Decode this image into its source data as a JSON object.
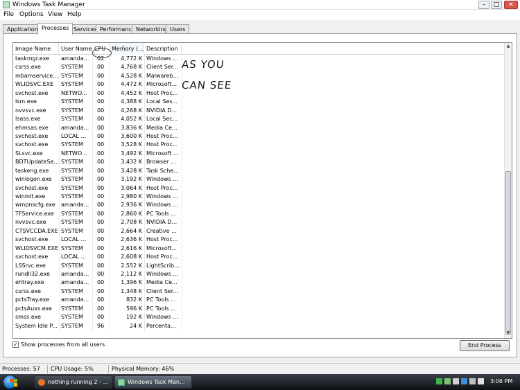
{
  "window": {
    "title": "Windows Task Manager",
    "controls": [
      "–",
      "□",
      "✕"
    ]
  },
  "menu": [
    "File",
    "Options",
    "View",
    "Help"
  ],
  "tabs": [
    "Applications",
    "Processes",
    "Services",
    "Performance",
    "Networking",
    "Users"
  ],
  "active_tab": "Processes",
  "columns": [
    "Image Name",
    "User Name",
    "CPU",
    "Memory (...",
    "Description"
  ],
  "processes": [
    [
      "taskmgr.exe",
      "amanda...",
      "02",
      "4,772 K",
      "Windows ..."
    ],
    [
      "csrss.exe",
      "SYSTEM",
      "00",
      "4,768 K",
      "Client Ser..."
    ],
    [
      "mbamservice....",
      "SYSTEM",
      "00",
      "4,528 K",
      "Malwareb..."
    ],
    [
      "WLIDSVC.EXE",
      "SYSTEM",
      "00",
      "4,472 K",
      "Microsoft..."
    ],
    [
      "svchost.exe",
      "NETWO...",
      "00",
      "4,452 K",
      "Host Proc..."
    ],
    [
      "lsm.exe",
      "SYSTEM",
      "00",
      "4,388 K",
      "Local Ses..."
    ],
    [
      "nvvsvc.exe",
      "SYSTEM",
      "00",
      "4,268 K",
      "NVIDIA D..."
    ],
    [
      "lsass.exe",
      "SYSTEM",
      "00",
      "4,052 K",
      "Local Sec..."
    ],
    [
      "ehmsas.exe",
      "amanda...",
      "00",
      "3,836 K",
      "Media Ce..."
    ],
    [
      "svchost.exe",
      "LOCAL ...",
      "00",
      "3,600 K",
      "Host Proc..."
    ],
    [
      "svchost.exe",
      "SYSTEM",
      "00",
      "3,528 K",
      "Host Proc..."
    ],
    [
      "SLsvc.exe",
      "NETWO...",
      "00",
      "3,492 K",
      "Microsoft ..."
    ],
    [
      "BDTUpdateSe...",
      "SYSTEM",
      "00",
      "3,432 K",
      "Browser ..."
    ],
    [
      "taskeng.exe",
      "SYSTEM",
      "00",
      "3,428 K",
      "Task Sche..."
    ],
    [
      "winlogon.exe",
      "SYSTEM",
      "00",
      "3,192 K",
      "Windows ..."
    ],
    [
      "svchost.exe",
      "SYSTEM",
      "00",
      "3,064 K",
      "Host Proc..."
    ],
    [
      "wininit.exe",
      "SYSTEM",
      "00",
      "2,980 K",
      "Windows ..."
    ],
    [
      "wmpnscfg.exe",
      "amanda...",
      "00",
      "2,936 K",
      "Windows ..."
    ],
    [
      "TFService.exe",
      "SYSTEM",
      "00",
      "2,860 K",
      "PC Tools ..."
    ],
    [
      "nvvsvc.exe",
      "SYSTEM",
      "00",
      "2,708 K",
      "NVIDIA D..."
    ],
    [
      "CTSVCCDA.EXE",
      "SYSTEM",
      "00",
      "2,664 K",
      "Creative ..."
    ],
    [
      "svchost.exe",
      "LOCAL ...",
      "00",
      "2,636 K",
      "Host Proc..."
    ],
    [
      "WLIDSVCM.EXE",
      "SYSTEM",
      "00",
      "2,616 K",
      "Microsoft..."
    ],
    [
      "svchost.exe",
      "LOCAL ...",
      "00",
      "2,608 K",
      "Host Proc..."
    ],
    [
      "LSSrvc.exe",
      "SYSTEM",
      "00",
      "2,552 K",
      "LightScrib..."
    ],
    [
      "rundll32.exe",
      "amanda...",
      "00",
      "2,112 K",
      "Windows ..."
    ],
    [
      "ehtray.exe",
      "amanda...",
      "00",
      "1,396 K",
      "Media Ce..."
    ],
    [
      "csrss.exe",
      "SYSTEM",
      "00",
      "1,348 K",
      "Client Ser..."
    ],
    [
      "pctsTray.exe",
      "amanda...",
      "00",
      "832 K",
      "PC Tools ..."
    ],
    [
      "pctsAuxs.exe",
      "SYSTEM",
      "00",
      "596 K",
      "PC Tools ..."
    ],
    [
      "smss.exe",
      "SYSTEM",
      "00",
      "192 K",
      "Windows ..."
    ],
    [
      "System Idle P...",
      "SYSTEM",
      "96",
      "24 K",
      "Percenta..."
    ]
  ],
  "annotation": {
    "line1": "AS YOU",
    "line2": "CAN SEE"
  },
  "show_all_users": {
    "label": "Show processes from all users",
    "checked": true,
    "check_glyph": "✓"
  },
  "end_process_label": "End Process",
  "status": {
    "processes": "Processes: 57",
    "cpu": "CPU Usage: 5%",
    "memory": "Physical Memory: 46%"
  },
  "taskbar": {
    "buttons": [
      "nothing running 2 - ...",
      "Windows Task Man..."
    ],
    "clock": "3:06 PM"
  },
  "colors": {
    "taskbar": "#1a1d22",
    "close_button": "#d9584a"
  }
}
